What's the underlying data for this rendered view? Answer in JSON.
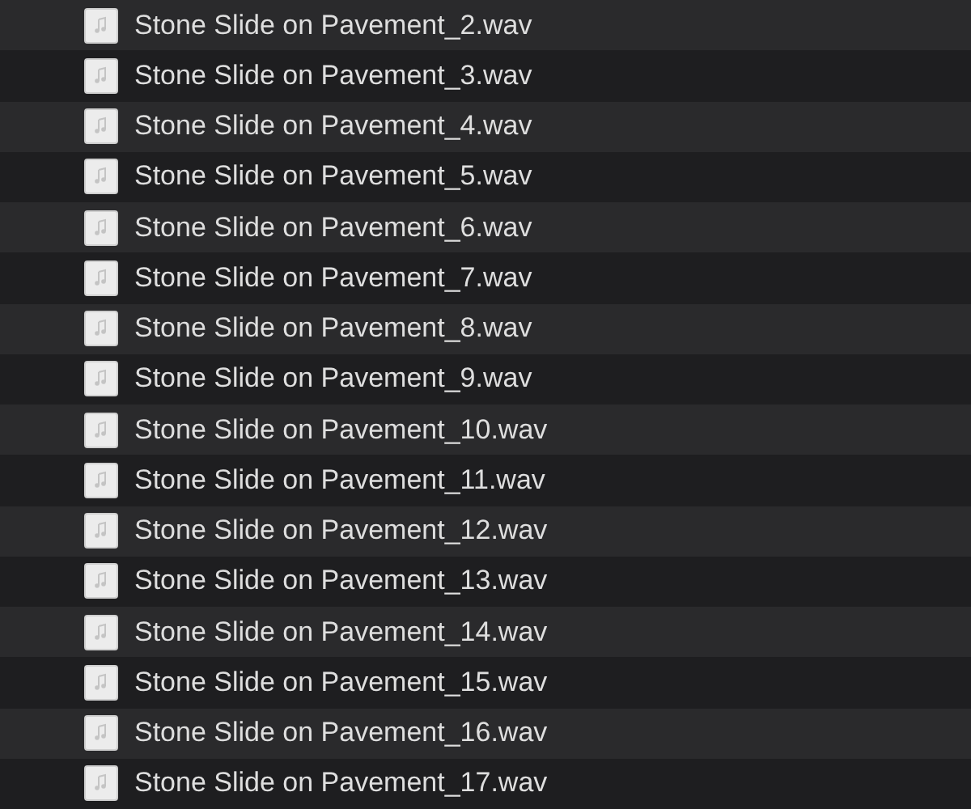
{
  "files": [
    {
      "name": "Stone Slide on Pavement_2.wav"
    },
    {
      "name": "Stone Slide on Pavement_3.wav"
    },
    {
      "name": "Stone Slide on Pavement_4.wav"
    },
    {
      "name": "Stone Slide on Pavement_5.wav"
    },
    {
      "name": "Stone Slide on Pavement_6.wav"
    },
    {
      "name": "Stone Slide on Pavement_7.wav"
    },
    {
      "name": "Stone Slide on Pavement_8.wav"
    },
    {
      "name": "Stone Slide on Pavement_9.wav"
    },
    {
      "name": "Stone Slide on Pavement_10.wav"
    },
    {
      "name": "Stone Slide on Pavement_11.wav"
    },
    {
      "name": "Stone Slide on Pavement_12.wav"
    },
    {
      "name": "Stone Slide on Pavement_13.wav"
    },
    {
      "name": "Stone Slide on Pavement_14.wav"
    },
    {
      "name": "Stone Slide on Pavement_15.wav"
    },
    {
      "name": "Stone Slide on Pavement_16.wav"
    },
    {
      "name": "Stone Slide on Pavement_17.wav"
    }
  ]
}
